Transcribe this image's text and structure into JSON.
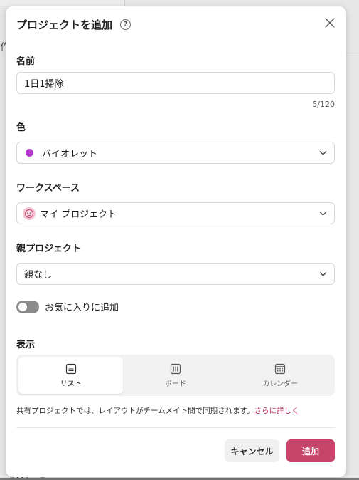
{
  "background": {
    "left_char": "作",
    "bottom_text": "調次レビュー"
  },
  "dialog": {
    "title": "プロジェクトを追加",
    "help_glyph": "?",
    "name": {
      "label": "名前",
      "value": "1日1掃除",
      "counter": "5/120"
    },
    "color": {
      "label": "色",
      "value": "バイオレット",
      "swatch": "#b03bc9"
    },
    "workspace": {
      "label": "ワークスペース",
      "value": "マイ プロジェクト",
      "avatar_icon": "face-icon"
    },
    "parent": {
      "label": "親プロジェクト",
      "value": "親なし"
    },
    "favorite": {
      "label": "お気に入りに追加",
      "on": false
    },
    "view": {
      "label": "表示",
      "options": [
        {
          "label": "リスト",
          "icon": "list-icon",
          "active": true
        },
        {
          "label": "ボード",
          "icon": "board-icon",
          "active": false
        },
        {
          "label": "カレンダー",
          "icon": "calendar-icon",
          "active": false
        }
      ]
    },
    "note": {
      "text": "共有プロジェクトでは、レイアウトがチームメイト間で同期されます。",
      "link": "さらに詳しく"
    },
    "buttons": {
      "cancel": "キャンセル",
      "add": "追加"
    }
  },
  "colors": {
    "accent": "#c7456b",
    "link": "#b5305a"
  }
}
